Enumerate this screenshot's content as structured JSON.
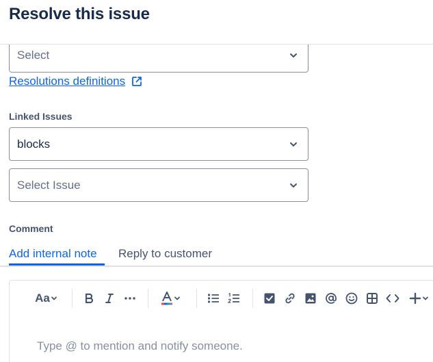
{
  "dialog": {
    "title": "Resolve this issue"
  },
  "resolution": {
    "placeholder": "Select",
    "definitions_link": "Resolutions definitions"
  },
  "linked_issues": {
    "label": "Linked Issues",
    "link_type": "blocks",
    "issue_placeholder": "Select Issue"
  },
  "comment": {
    "label": "Comment",
    "tabs": [
      {
        "label": "Add internal note",
        "active": true
      },
      {
        "label": "Reply to customer",
        "active": false
      }
    ],
    "editor_placeholder": "Type @ to mention and notify someone.",
    "toolbar": {
      "text_style": "Aa",
      "icons": [
        "bold-icon",
        "italic-icon",
        "more-formatting-icon",
        "text-color-icon",
        "bullet-list-icon",
        "numbered-list-icon",
        "checkbox-icon",
        "link-icon",
        "image-icon",
        "mention-icon",
        "emoji-icon",
        "table-icon",
        "code-icon",
        "insert-plus-icon"
      ]
    }
  },
  "colors": {
    "accent": "#0c66e4",
    "text": "#172b4d",
    "subtle_text": "#44546f",
    "placeholder": "#626f86",
    "border": "#8590a2"
  }
}
